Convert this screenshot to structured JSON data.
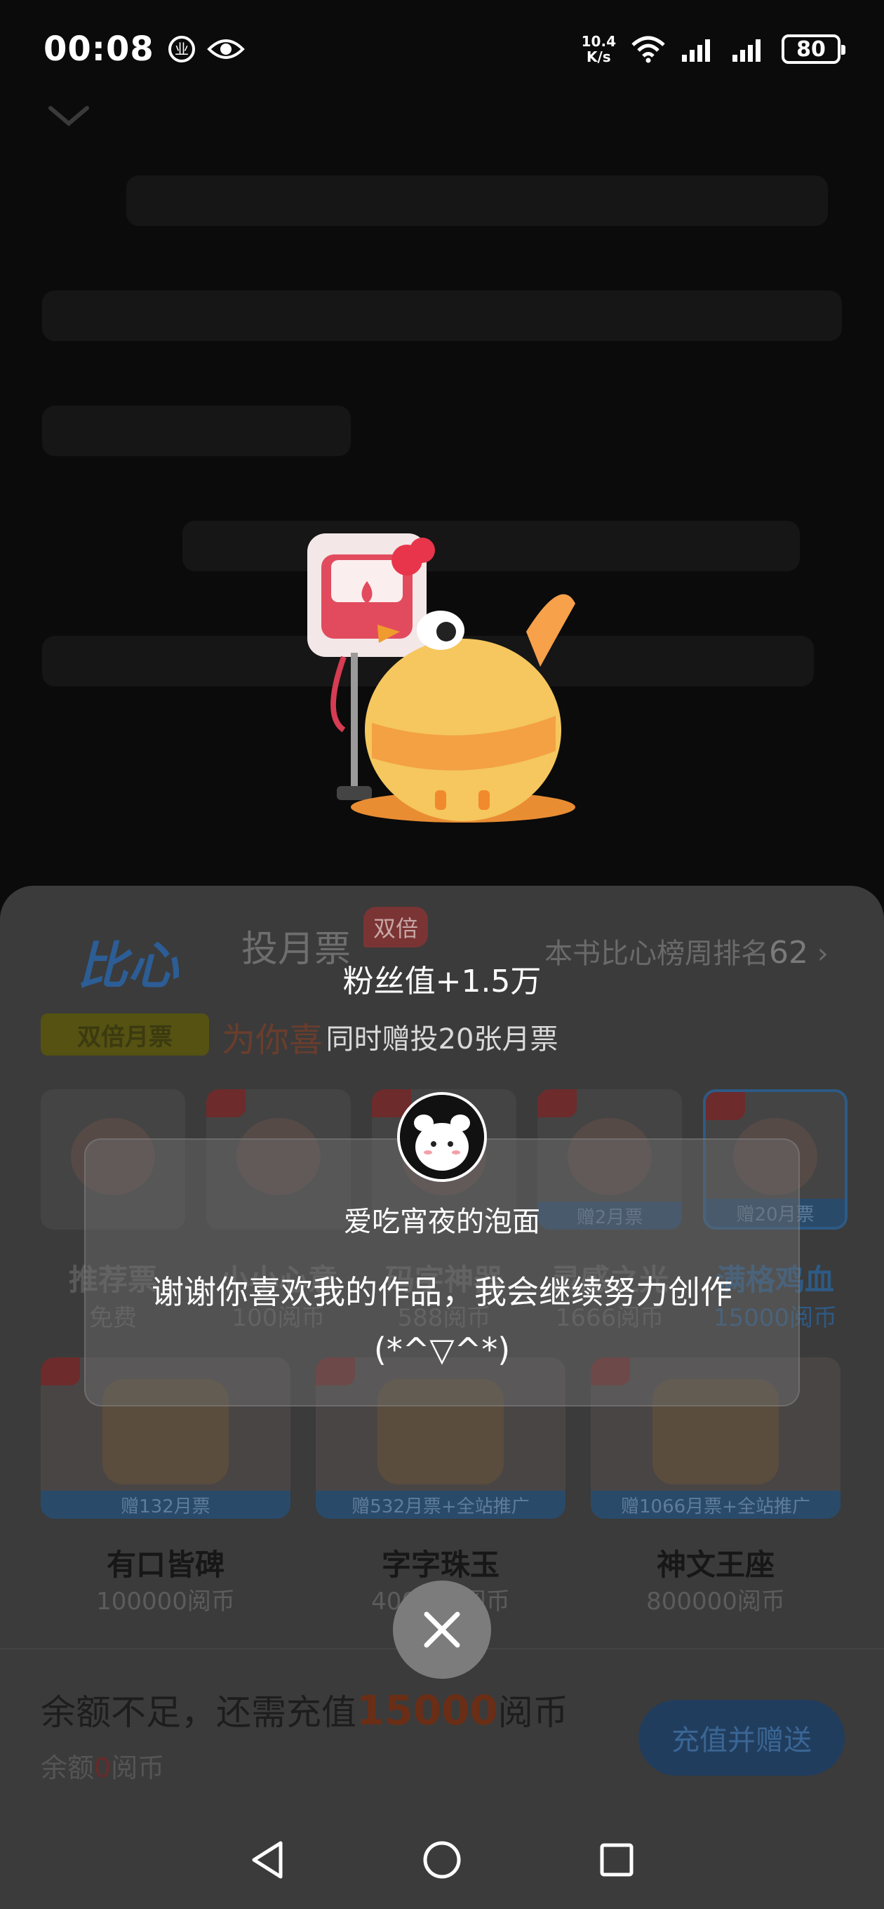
{
  "status_bar": {
    "time": "00:08",
    "net_speed_value": "10.4",
    "net_speed_unit": "K/s",
    "battery": "80",
    "icons": [
      "notification-icon",
      "eye-icon",
      "wifi-icon",
      "signal-icon",
      "signal-icon",
      "battery-icon"
    ]
  },
  "sheet": {
    "logo": "比心",
    "title": "投月票",
    "double_badge": "双倍",
    "rank_prefix": "本书比心榜周排名",
    "rank_value": "62",
    "double_ticket_tag": "双倍月票",
    "promo": "为你喜",
    "gifts_row1": [
      {
        "name": "推荐票",
        "price": "免费",
        "bonus": ""
      },
      {
        "name": "小小心意",
        "price": "100阅币",
        "bonus": ""
      },
      {
        "name": "码字神器",
        "price": "588阅币",
        "bonus": ""
      },
      {
        "name": "灵感之光",
        "price": "1666阅币",
        "bonus": "赠2月票"
      },
      {
        "name": "满格鸡血",
        "price": "15000阅币",
        "bonus": "赠20月票"
      }
    ],
    "gifts_row2": [
      {
        "name": "有口皆碑",
        "price": "100000阅币",
        "bonus": "赠132月票"
      },
      {
        "name": "字字珠玉",
        "price": "400000阅币",
        "bonus": "赠532月票+全站推广"
      },
      {
        "name": "神文王座",
        "price": "800000阅币",
        "bonus": "赠1066月票+全站推广"
      }
    ],
    "insufficient_prefix": "余额不足，还需充值",
    "insufficient_amount": "15000",
    "insufficient_suffix": "阅币",
    "balance_prefix": "余额",
    "balance_value": "0",
    "balance_suffix": "阅币",
    "recharge_label": "充值并赠送"
  },
  "popup": {
    "fan_gain": "粉丝值+1.5万",
    "gift_votes": "同时赠投20张月票",
    "author_name": "爱吃宵夜的泡面",
    "thanks_message": "谢谢你喜欢我的作品，我会继续努力创作(*^▽^*)"
  },
  "colors": {
    "accent_blue": "#2d5a85",
    "accent_red": "#c0392b",
    "overlay": "#0b0b0b"
  }
}
